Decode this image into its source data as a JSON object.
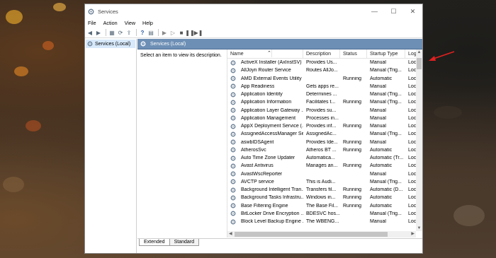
{
  "window": {
    "title": "Services",
    "controls": {
      "minimize": "—",
      "maximize": "☐",
      "close": "✕"
    }
  },
  "menu": [
    "File",
    "Action",
    "View",
    "Help"
  ],
  "tree": {
    "item": "Services (Local)"
  },
  "pane": {
    "header": "Services (Local)",
    "description": "Select an item to view its description."
  },
  "columns": {
    "name": "Name",
    "description": "Description",
    "status": "Status",
    "startup": "Startup Type",
    "logon": "Log"
  },
  "services": [
    {
      "name": "ActiveX Installer (AxInstSV)",
      "description": "Provides Us...",
      "status": "",
      "startup": "Manual",
      "logon": "Loc"
    },
    {
      "name": "AllJoyn Router Service",
      "description": "Routes AllJo...",
      "status": "",
      "startup": "Manual (Trig...",
      "logon": "Loc"
    },
    {
      "name": "AMD External Events Utility",
      "description": "",
      "status": "Running",
      "startup": "Automatic",
      "logon": "Loc"
    },
    {
      "name": "App Readiness",
      "description": "Gets apps re...",
      "status": "",
      "startup": "Manual",
      "logon": "Loc"
    },
    {
      "name": "Application Identity",
      "description": "Determines ...",
      "status": "",
      "startup": "Manual (Trig...",
      "logon": "Loc"
    },
    {
      "name": "Application Information",
      "description": "Facilitates t...",
      "status": "Running",
      "startup": "Manual (Trig...",
      "logon": "Loc"
    },
    {
      "name": "Application Layer Gateway ...",
      "description": "Provides su...",
      "status": "",
      "startup": "Manual",
      "logon": "Loc"
    },
    {
      "name": "Application Management",
      "description": "Processes in...",
      "status": "",
      "startup": "Manual",
      "logon": "Loc"
    },
    {
      "name": "AppX Deployment Service (...",
      "description": "Provides inf...",
      "status": "Running",
      "startup": "Manual",
      "logon": "Loc"
    },
    {
      "name": "AssignedAccessManager Se...",
      "description": "AssignedAc...",
      "status": "",
      "startup": "Manual (Trig...",
      "logon": "Loc"
    },
    {
      "name": "aswbIDSAgent",
      "description": "Provides Ide...",
      "status": "Running",
      "startup": "Manual",
      "logon": "Loc"
    },
    {
      "name": "AtherosSvc",
      "description": "Atheros BT ...",
      "status": "Running",
      "startup": "Automatic",
      "logon": "Loc"
    },
    {
      "name": "Auto Time Zone Updater",
      "description": "Automatica...",
      "status": "",
      "startup": "Automatic (Tr...",
      "logon": "Loc"
    },
    {
      "name": "Avast Antivirus",
      "description": "Manages an...",
      "status": "Running",
      "startup": "Automatic",
      "logon": "Loc"
    },
    {
      "name": "AvastWscReporter",
      "description": "",
      "status": "",
      "startup": "Manual",
      "logon": "Loc"
    },
    {
      "name": "AVCTP service",
      "description": "This is Audi...",
      "status": "",
      "startup": "Manual (Trig...",
      "logon": "Loc"
    },
    {
      "name": "Background Intelligent Tran...",
      "description": "Transfers fil...",
      "status": "Running",
      "startup": "Automatic (D...",
      "logon": "Loc"
    },
    {
      "name": "Background Tasks Infrastru...",
      "description": "Windows in...",
      "status": "Running",
      "startup": "Automatic",
      "logon": "Loc"
    },
    {
      "name": "Base Filtering Engine",
      "description": "The Base Fil...",
      "status": "Running",
      "startup": "Automatic",
      "logon": "Loc"
    },
    {
      "name": "BitLocker Drive Encryption ...",
      "description": "BDESVC hos...",
      "status": "",
      "startup": "Manual (Trig...",
      "logon": "Loc"
    },
    {
      "name": "Block Level Backup Engine ...",
      "description": "The WBENG...",
      "status": "",
      "startup": "Manual",
      "logon": "Loc"
    }
  ],
  "tabs": {
    "extended": "Extended",
    "standard": "Standard"
  },
  "colors": {
    "header": "#6d8fb5",
    "selected_tree": "#d7e9fb",
    "arrow": "#e02020"
  }
}
